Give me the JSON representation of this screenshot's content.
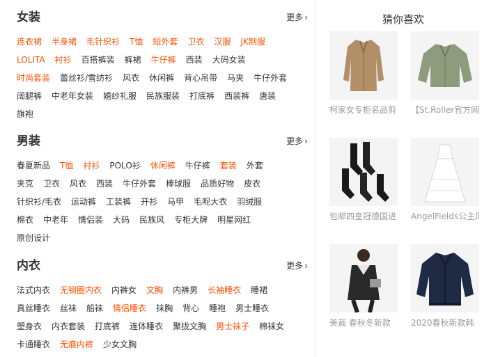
{
  "women": {
    "title": "女装",
    "more": "更多",
    "rows": [
      [
        {
          "t": "连衣裙",
          "hot": true
        },
        {
          "t": "半身裙",
          "hot": true
        },
        {
          "t": "毛针织衫",
          "hot": true
        },
        {
          "t": "T恤",
          "hot": true
        },
        {
          "t": "短外套",
          "hot": true
        },
        {
          "t": "卫衣",
          "hot": true
        },
        {
          "t": "汉服",
          "hot": true
        },
        {
          "t": "JK制服",
          "hot": true
        }
      ],
      [
        {
          "t": "LOLITA",
          "hot": true
        },
        {
          "t": "衬衫",
          "hot": true
        },
        {
          "t": "百搭裤装",
          "hot": false
        },
        {
          "t": "裤裙",
          "hot": false
        },
        {
          "t": "牛仔裤",
          "hot": true
        },
        {
          "t": "西装",
          "hot": false
        },
        {
          "t": "大码女装",
          "hot": false
        }
      ],
      [
        {
          "t": "时尚套装",
          "hot": true
        },
        {
          "t": "蕾丝衫/雪纺衫",
          "hot": false
        },
        {
          "t": "风衣",
          "hot": false
        },
        {
          "t": "休闲裤",
          "hot": false
        },
        {
          "t": "背心吊带",
          "hot": false
        },
        {
          "t": "马夹",
          "hot": false
        },
        {
          "t": "牛仔外套",
          "hot": false
        }
      ],
      [
        {
          "t": "阔腿裤",
          "hot": false
        },
        {
          "t": "中老年女装",
          "hot": false
        },
        {
          "t": "婚纱礼服",
          "hot": false
        },
        {
          "t": "民族服装",
          "hot": false
        },
        {
          "t": "打底裤",
          "hot": false
        },
        {
          "t": "西装裤",
          "hot": false
        },
        {
          "t": "唐装",
          "hot": false
        }
      ],
      [
        {
          "t": "旗袍",
          "hot": false
        }
      ]
    ]
  },
  "men": {
    "title": "男装",
    "more": "更多",
    "rows": [
      [
        {
          "t": "春夏新品",
          "hot": false
        },
        {
          "t": "T恤",
          "hot": true
        },
        {
          "t": "衬衫",
          "hot": true
        },
        {
          "t": "POLO衫",
          "hot": false
        },
        {
          "t": "休闲裤",
          "hot": true
        },
        {
          "t": "牛仔裤",
          "hot": false
        },
        {
          "t": "套装",
          "hot": true
        },
        {
          "t": "外套",
          "hot": false
        }
      ],
      [
        {
          "t": "夹克",
          "hot": false
        },
        {
          "t": "卫衣",
          "hot": false
        },
        {
          "t": "风衣",
          "hot": false
        },
        {
          "t": "西装",
          "hot": false
        },
        {
          "t": "牛仔外套",
          "hot": false
        },
        {
          "t": "棒球服",
          "hot": false
        },
        {
          "t": "品质好物",
          "hot": false
        },
        {
          "t": "皮衣",
          "hot": false
        }
      ],
      [
        {
          "t": "针织衫/毛衣",
          "hot": false
        },
        {
          "t": "运动裤",
          "hot": false
        },
        {
          "t": "工装裤",
          "hot": false
        },
        {
          "t": "开衫",
          "hot": false
        },
        {
          "t": "马甲",
          "hot": false
        },
        {
          "t": "毛呢大衣",
          "hot": false
        },
        {
          "t": "羽绒服",
          "hot": false
        }
      ],
      [
        {
          "t": "棉衣",
          "hot": false
        },
        {
          "t": "中老年",
          "hot": false
        },
        {
          "t": "情侣装",
          "hot": false
        },
        {
          "t": "大码",
          "hot": false
        },
        {
          "t": "民族风",
          "hot": false
        },
        {
          "t": "专柜大牌",
          "hot": false
        },
        {
          "t": "明星网红",
          "hot": false
        }
      ],
      [
        {
          "t": "原创设计",
          "hot": false
        }
      ]
    ]
  },
  "underwear": {
    "title": "内衣",
    "more": "更多",
    "rows": [
      [
        {
          "t": "法式内衣",
          "hot": false
        },
        {
          "t": "无钢圈内衣",
          "hot": true
        },
        {
          "t": "内裤女",
          "hot": false
        },
        {
          "t": "文胸",
          "hot": true
        },
        {
          "t": "内裤男",
          "hot": false
        },
        {
          "t": "长袖睡衣",
          "hot": true
        },
        {
          "t": "睡裙",
          "hot": false
        }
      ],
      [
        {
          "t": "真丝睡衣",
          "hot": false
        },
        {
          "t": "丝袜",
          "hot": false
        },
        {
          "t": "船袜",
          "hot": false
        },
        {
          "t": "情侣睡衣",
          "hot": true
        },
        {
          "t": "抹胸",
          "hot": false
        },
        {
          "t": "背心",
          "hot": false
        },
        {
          "t": "睡袍",
          "hot": false
        },
        {
          "t": "男士睡衣",
          "hot": false
        }
      ],
      [
        {
          "t": "塑身衣",
          "hot": false
        },
        {
          "t": "内衣套装",
          "hot": false
        },
        {
          "t": "打底裤",
          "hot": false
        },
        {
          "t": "连体睡衣",
          "hot": false
        },
        {
          "t": "聚拢文胸",
          "hot": false
        },
        {
          "t": "男士袜子",
          "hot": true
        },
        {
          "t": "棉袜女",
          "hot": false
        }
      ],
      [
        {
          "t": "卡通睡衣",
          "hot": false
        },
        {
          "t": "无痕内裤",
          "hot": true
        },
        {
          "t": "少女文胸",
          "hot": false
        }
      ]
    ]
  },
  "recommend": {
    "title": "猜你喜欢",
    "items": [
      {
        "caption": "柯家女专柜名品剪",
        "icon": "coat-image"
      },
      {
        "caption": "【St.Roller官方网",
        "icon": "jacket-image"
      },
      {
        "caption": "包邮四皇冠德国进",
        "icon": "socks-image"
      },
      {
        "caption": "AngelFields公主风",
        "icon": "dress-image"
      },
      {
        "caption": "美裁 春秋冬新款",
        "icon": "model-jacket-image"
      },
      {
        "caption": "2020春秋新款韩",
        "icon": "bomber-jacket-image"
      }
    ]
  },
  "colors": {
    "accent": "#ff5000",
    "text": "#333333",
    "muted": "#999999"
  }
}
